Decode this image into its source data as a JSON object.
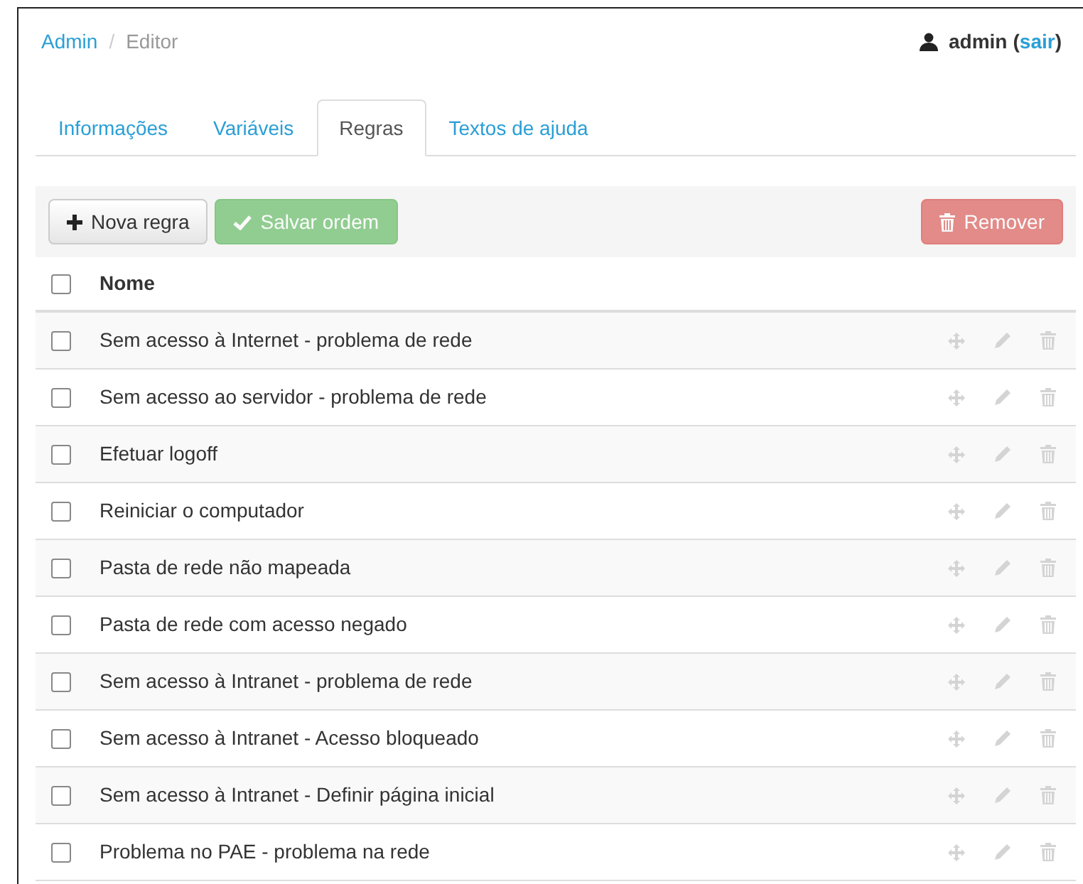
{
  "breadcrumb": [
    {
      "label": "Admin",
      "kind": "link"
    },
    {
      "label": "/",
      "kind": "separator"
    },
    {
      "label": "Editor",
      "kind": "current"
    }
  ],
  "user": {
    "name": "admin",
    "open": "(",
    "logout": "sair",
    "close": ")"
  },
  "tabs": [
    {
      "label": "Informações",
      "selected": false
    },
    {
      "label": "Variáveis",
      "selected": false
    },
    {
      "label": "Regras",
      "selected": true
    },
    {
      "label": "Textos de ajuda",
      "selected": false
    }
  ],
  "toolbar": [
    {
      "label": "Nova regra",
      "kind": "add",
      "disabled": false
    },
    {
      "label": "Salvar ordem",
      "kind": "save",
      "disabled": true
    },
    {
      "label": "Remover",
      "kind": "remove",
      "disabled": true
    }
  ],
  "table": {
    "header": {
      "label": "Nome",
      "checked": false
    },
    "rows": [
      {
        "name": "Sem acesso à Internet - problema de rede",
        "checked": false
      },
      {
        "name": "Sem acesso ao servidor - problema de rede",
        "checked": false
      },
      {
        "name": "Efetuar logoff",
        "checked": false
      },
      {
        "name": "Reiniciar o computador",
        "checked": false
      },
      {
        "name": "Pasta de rede não mapeada",
        "checked": false
      },
      {
        "name": "Pasta de rede com acesso negado",
        "checked": false
      },
      {
        "name": "Sem acesso à Intranet - problema de rede",
        "checked": false
      },
      {
        "name": "Sem acesso à Intranet - Acesso bloqueado",
        "checked": false
      },
      {
        "name": "Sem acesso à Intranet - Definir página inicial",
        "checked": false
      },
      {
        "name": "Problema no PAE - problema na rede",
        "checked": false
      }
    ]
  }
}
